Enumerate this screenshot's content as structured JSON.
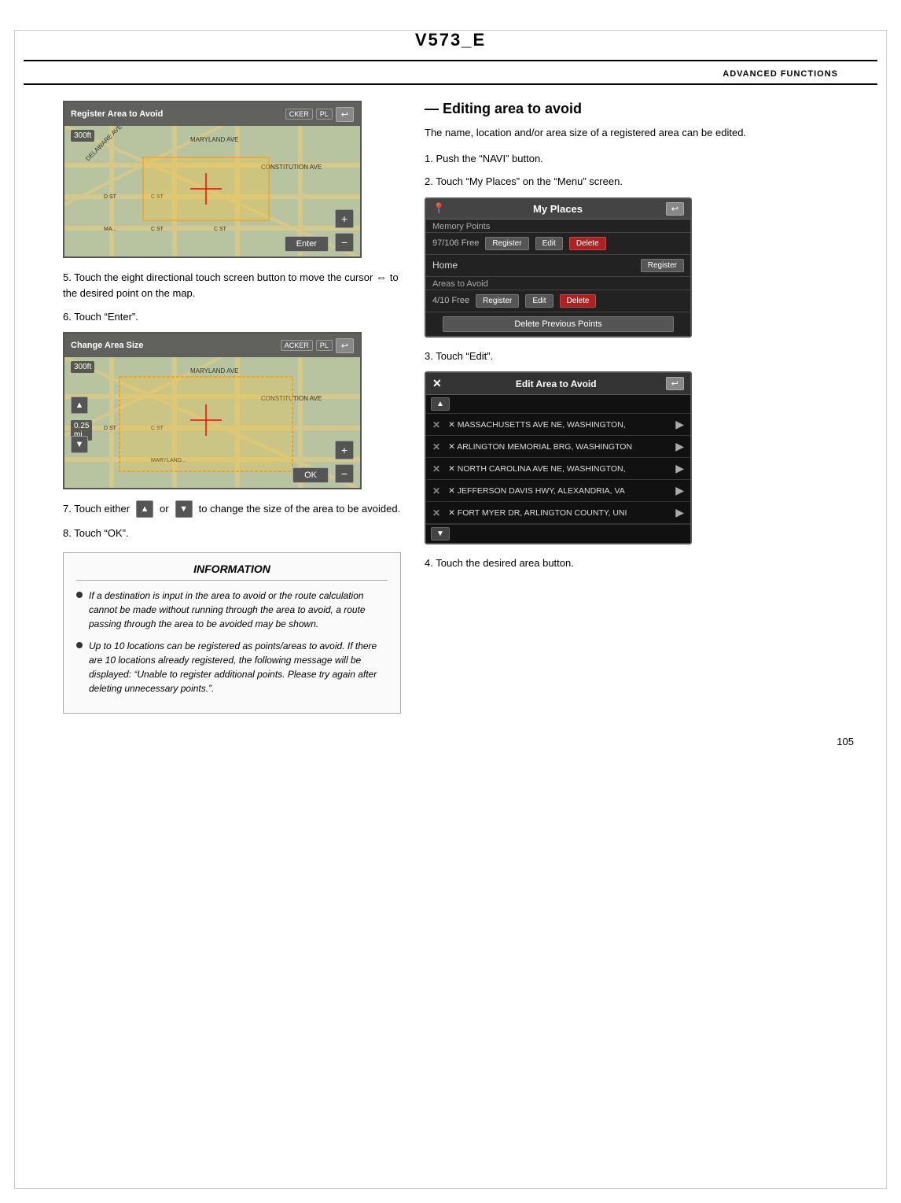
{
  "header": {
    "title": "V573_E"
  },
  "section_header": {
    "text": "ADVANCED FUNCTIONS"
  },
  "left": {
    "map1": {
      "toolbar_text": "Register Area to Avoid",
      "toolbar_btns": [
        "CKER",
        "PL"
      ],
      "zoom_label": "300ft",
      "enter_btn": "Enter"
    },
    "step5": "5.    Touch the eight directional touch screen button to move the cursor",
    "step5b": "to the desired point on the map.",
    "step6": "6.    Touch “Enter”.",
    "map2": {
      "toolbar_text": "Change Area Size",
      "toolbar_btns": [
        "ACKER",
        "PL"
      ],
      "zoom_label": "300ft",
      "size_label": "0.25\nmi",
      "ok_btn": "OK"
    },
    "step7_prefix": "7.    Touch either",
    "step7_or": "or",
    "step7_suffix": "to change the size of the area to be avoided.",
    "step8": "8.    Touch “OK”.",
    "info": {
      "title": "INFORMATION",
      "items": [
        "If a destination is input in the area to avoid or the route calculation cannot be made without running through the area to avoid, a route passing through the area to be avoided may be shown.",
        "Up to 10 locations can be registered as points/areas to avoid.   If there are 10 locations already registered, the following message will be displayed: “Unable to register additional points.    Please try again after deleting unnecessary points.”."
      ]
    }
  },
  "right": {
    "section_title": "— Editing area to avoid",
    "intro": "The name, location and/or area size of a registered area can be edited.",
    "step1": "1.    Push the “NAVI” button.",
    "step2": "2.    Touch “My Places” on the “Menu” screen.",
    "my_places": {
      "title": "My Places",
      "back_btn": "↩",
      "memory_points_label": "Memory Points",
      "memory_count": "97/106 Free",
      "memory_btns": [
        "Register",
        "Edit",
        "Delete"
      ],
      "home_label": "Home",
      "home_btns": [
        "Register"
      ],
      "areas_label": "Areas to Avoid",
      "areas_count": "4/10 Free",
      "areas_btns": [
        "Register",
        "Edit",
        "Delete"
      ],
      "delete_btn": "Delete Previous Points"
    },
    "step3": "3.    Touch “Edit”.",
    "edit_area": {
      "title": "Edit Area to Avoid",
      "back_btn": "↩",
      "rows": [
        "✕ MASSACHUSETTS AVE NE, WASHINGTON,",
        "✕ ARLINGTON MEMORIAL BRG, WASHINGTON",
        "✕ NORTH CAROLINA AVE NE, WASHINGTON,",
        "✕ JEFFERSON DAVIS HWY, ALEXANDRIA, VA",
        "✕ FORT MYER DR, ARLINGTON COUNTY, UNI"
      ]
    },
    "step4": "4.    Touch the desired area button."
  },
  "page_number": "105"
}
